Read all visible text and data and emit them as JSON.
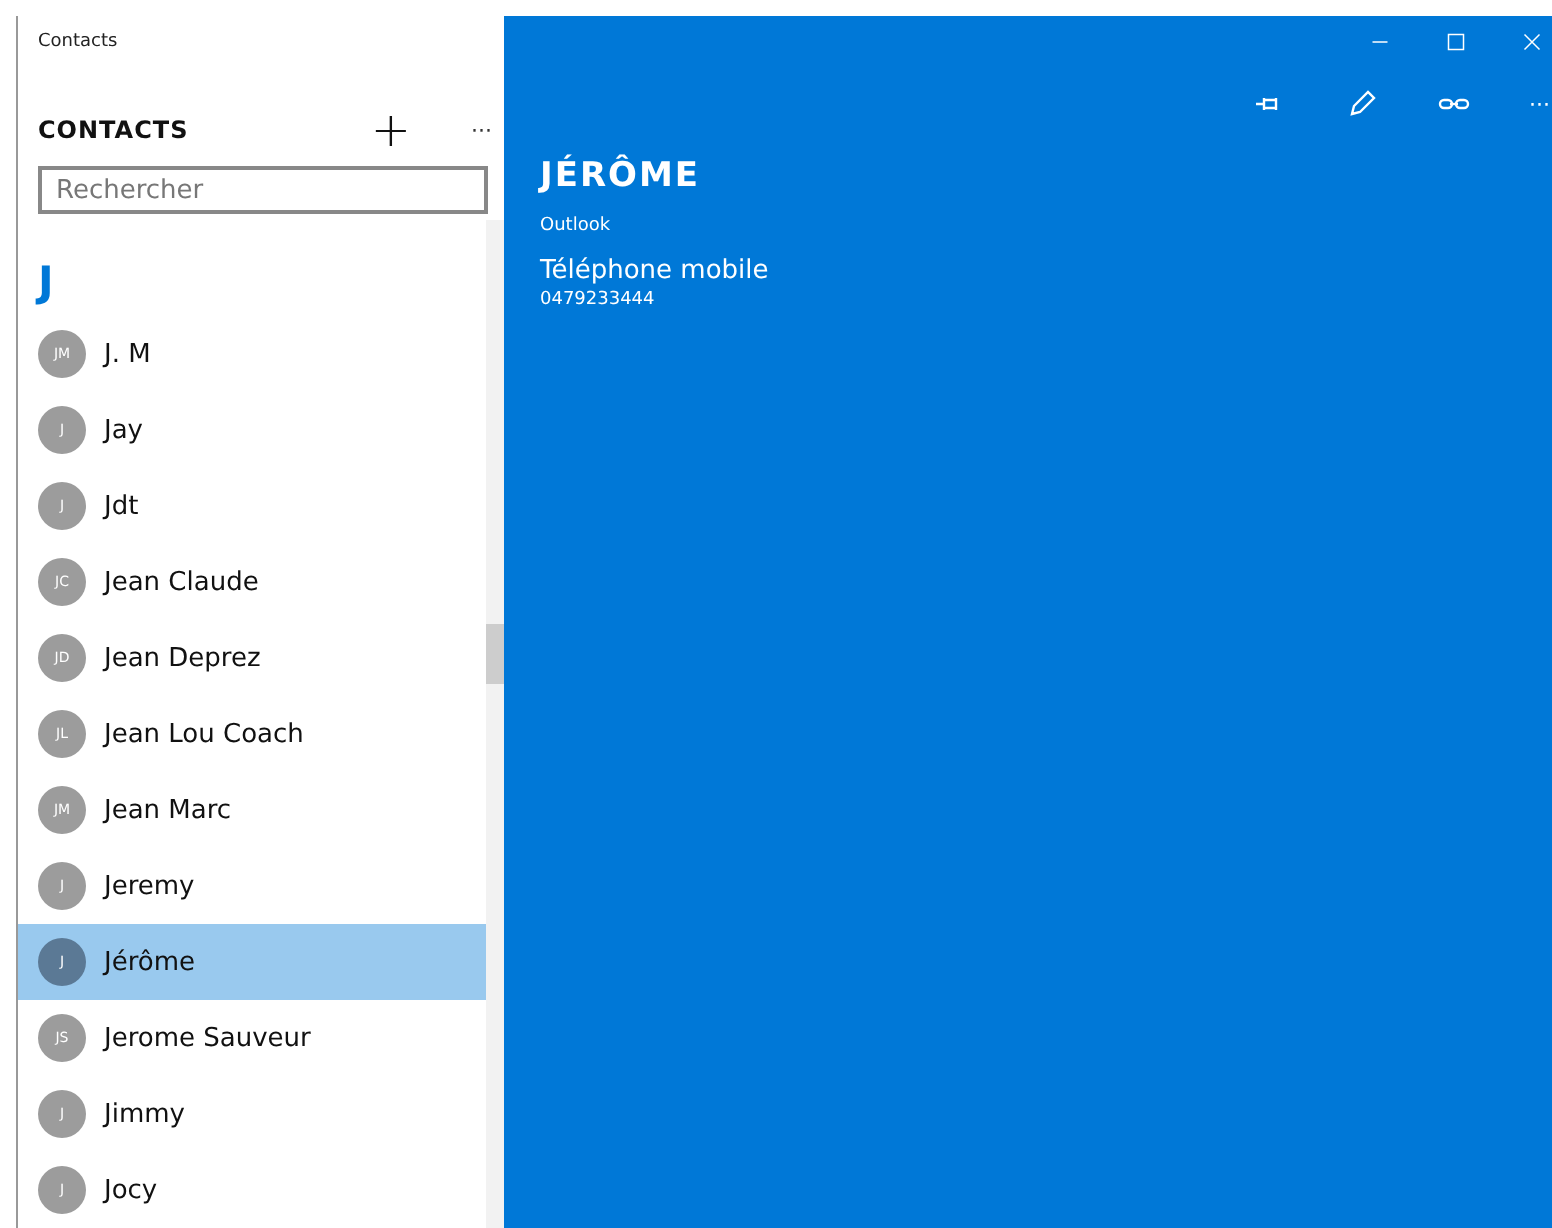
{
  "window": {
    "title": "Contacts"
  },
  "sidebar": {
    "heading": "CONTACTS",
    "add": "+",
    "more": "···",
    "search": {
      "placeholder": "Rechercher"
    },
    "group_letter": "J",
    "contacts": [
      {
        "initials": "JM",
        "name": "J. M",
        "selected": false
      },
      {
        "initials": "J",
        "name": "Jay",
        "selected": false
      },
      {
        "initials": "J",
        "name": "Jdt",
        "selected": false
      },
      {
        "initials": "JC",
        "name": "Jean Claude",
        "selected": false
      },
      {
        "initials": "JD",
        "name": "Jean Deprez",
        "selected": false
      },
      {
        "initials": "JL",
        "name": "Jean Lou Coach",
        "selected": false
      },
      {
        "initials": "JM",
        "name": "Jean Marc",
        "selected": false
      },
      {
        "initials": "J",
        "name": "Jeremy",
        "selected": false
      },
      {
        "initials": "J",
        "name": "Jérôme",
        "selected": true
      },
      {
        "initials": "JS",
        "name": "Jerome Sauveur",
        "selected": false
      },
      {
        "initials": "J",
        "name": "Jimmy",
        "selected": false
      },
      {
        "initials": "J",
        "name": "Jocy",
        "selected": false
      }
    ]
  },
  "detail": {
    "name": "JÉRÔME",
    "source": "Outlook",
    "field_label": "Téléphone mobile",
    "field_value": "0479233444",
    "more": "···"
  }
}
